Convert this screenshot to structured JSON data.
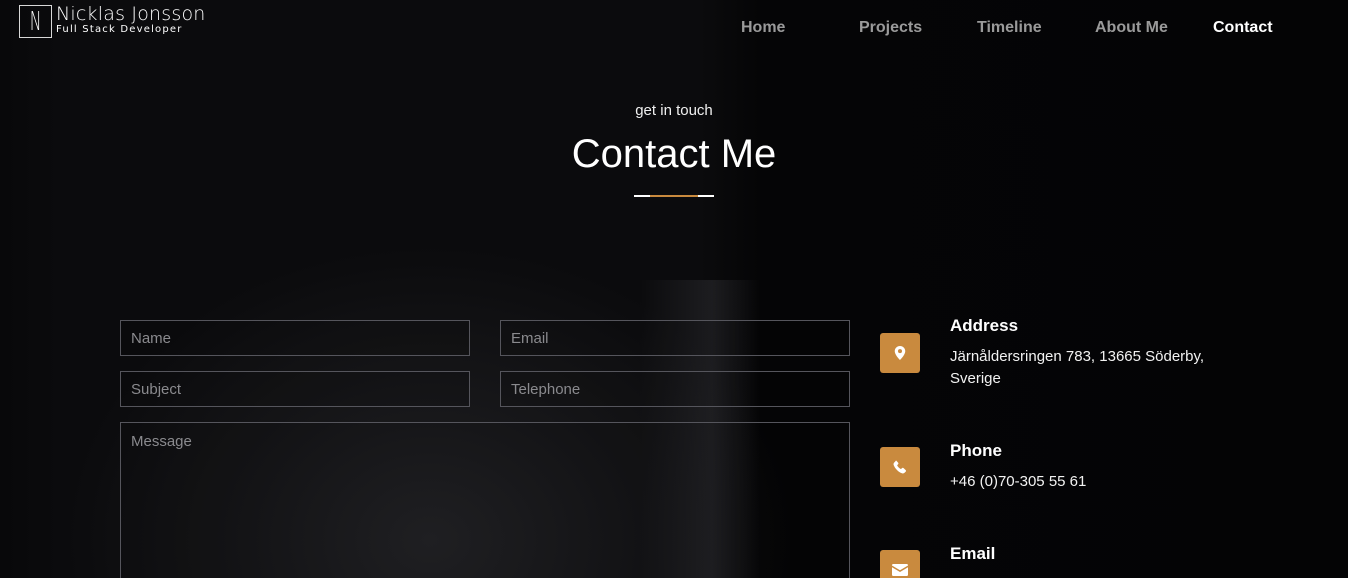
{
  "brand": {
    "initial": "N",
    "name": "Nicklas Jonsson",
    "role": "Full Stack Developer"
  },
  "nav": [
    {
      "label": "Home",
      "active": false
    },
    {
      "label": "Projects",
      "active": false
    },
    {
      "label": "Timeline",
      "active": false
    },
    {
      "label": "About Me",
      "active": false
    },
    {
      "label": "Contact",
      "active": true
    }
  ],
  "hero": {
    "eyebrow": "get in touch",
    "title": "Contact Me"
  },
  "form": {
    "name_placeholder": "Name",
    "email_placeholder": "Email",
    "subject_placeholder": "Subject",
    "telephone_placeholder": "Telephone",
    "message_placeholder": "Message"
  },
  "contact": {
    "address": {
      "icon": "map-marker-icon",
      "title": "Address",
      "text": "Järnåldersringen 783, 13665 Söderby, Sverige"
    },
    "phone": {
      "icon": "phone-icon",
      "title": "Phone",
      "text": "+46 (0)70-305 55 61"
    },
    "email": {
      "icon": "envelope-icon",
      "title": "Email"
    }
  },
  "colors": {
    "accent": "#c98a3e",
    "background": "#060608",
    "nav_inactive": "#9a9a9a",
    "nav_active": "#ffffff"
  }
}
